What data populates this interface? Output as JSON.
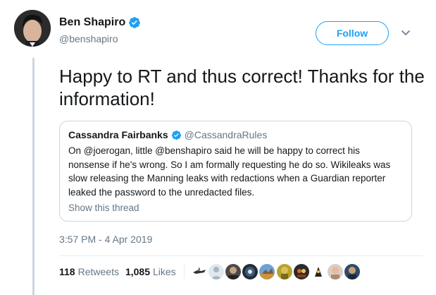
{
  "author": {
    "name": "Ben Shapiro",
    "handle": "@benshapiro",
    "verified": true
  },
  "follow_label": "Follow",
  "tweet_text": "Happy to RT and thus correct! Thanks for the information!",
  "quoted": {
    "name": "Cassandra Fairbanks",
    "handle": "@CassandraRules",
    "verified": true,
    "text": "On @joerogan, little @benshapiro said he will be happy to correct his nonsense if he's wrong. So I am formally requesting he do so. Wikileaks was slow releasing the Manning leaks with redactions when a Guardian reporter leaked the password to the unredacted files.",
    "show_thread_label": "Show this thread"
  },
  "timestamp": "3:57 PM - 4 Apr 2019",
  "stats": {
    "retweets_count": "118",
    "retweets_label": "Retweets",
    "likes_count": "1,085",
    "likes_label": "Likes"
  },
  "colors": {
    "accent": "#1da1f2",
    "secondary_text": "#657786",
    "border": "#ccd6dd"
  },
  "icons": [
    "verified-badge-icon",
    "chevron-down-icon"
  ],
  "liker_avatars_count": 10
}
